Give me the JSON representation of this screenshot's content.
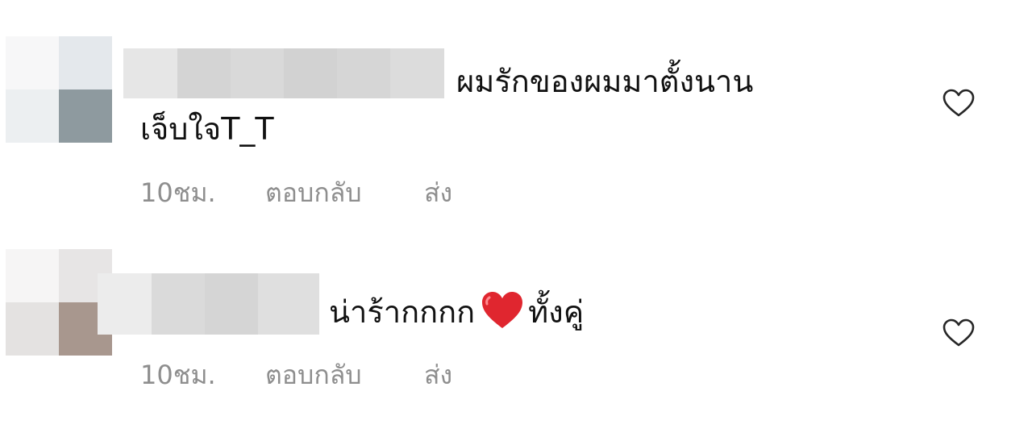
{
  "comments": [
    {
      "line1": "ผมรักของผมมาตั้งนาน",
      "line2": "เจ็บใจT_T",
      "time": "10ชม.",
      "reply_label": "ตอบกลับ",
      "send_label": "ส่ง",
      "like_icon": "heart-outline-icon"
    },
    {
      "text_before_emoji": "น่าร้ากกกก",
      "emoji": "red-heart-emoji",
      "text_after_emoji": "ทั้งคู่",
      "time": "10ชม.",
      "reply_label": "ตอบกลับ",
      "send_label": "ส่ง",
      "like_icon": "heart-outline-icon"
    }
  ],
  "colors": {
    "text": "#111111",
    "meta_text": "#8e8e8e",
    "emoji_heart": "#e0262f"
  }
}
